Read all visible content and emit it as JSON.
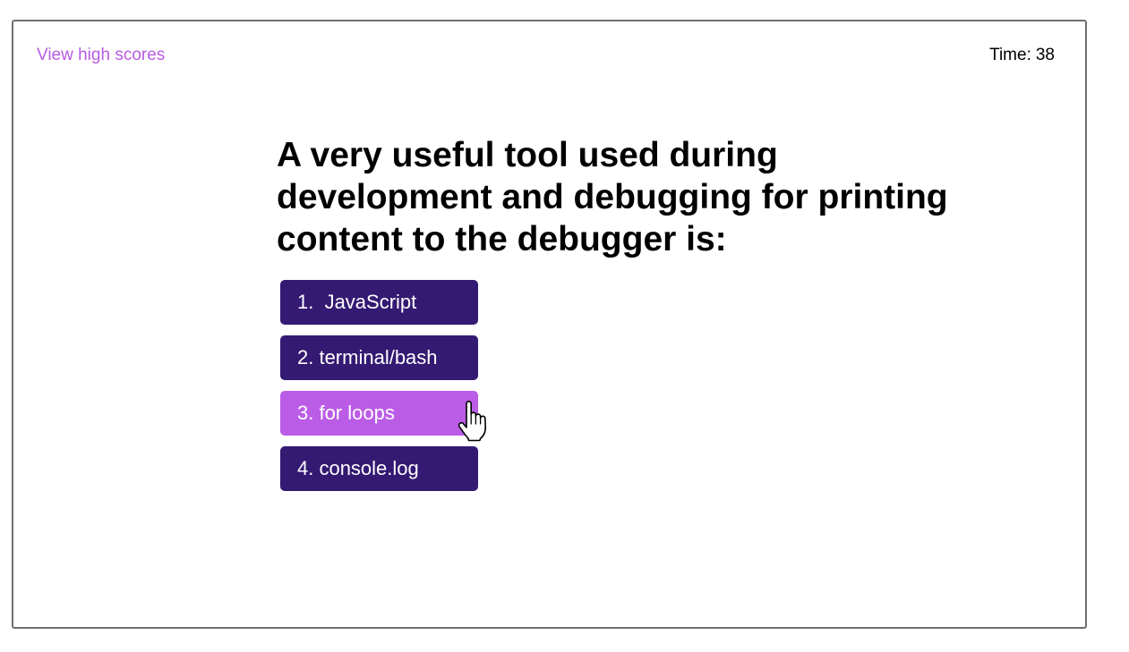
{
  "header": {
    "highscores_label": "View high scores",
    "timer_label": "Time:",
    "timer_value": "38"
  },
  "quiz": {
    "question": "A very useful tool used during development and debugging for printing content to the debugger is:",
    "answers": [
      {
        "label": "1.  JavaScript",
        "state": "default"
      },
      {
        "label": "2. terminal/bash",
        "state": "default"
      },
      {
        "label": "3. for loops",
        "state": "hover"
      },
      {
        "label": "4. console.log",
        "state": "default"
      }
    ]
  },
  "colors": {
    "accent": "#b95be3",
    "button": "#341a73",
    "button_hover": "#bb5ce6",
    "frame_border": "#6f6f6f"
  },
  "cursor": {
    "icon": "pointer-hand-icon"
  }
}
